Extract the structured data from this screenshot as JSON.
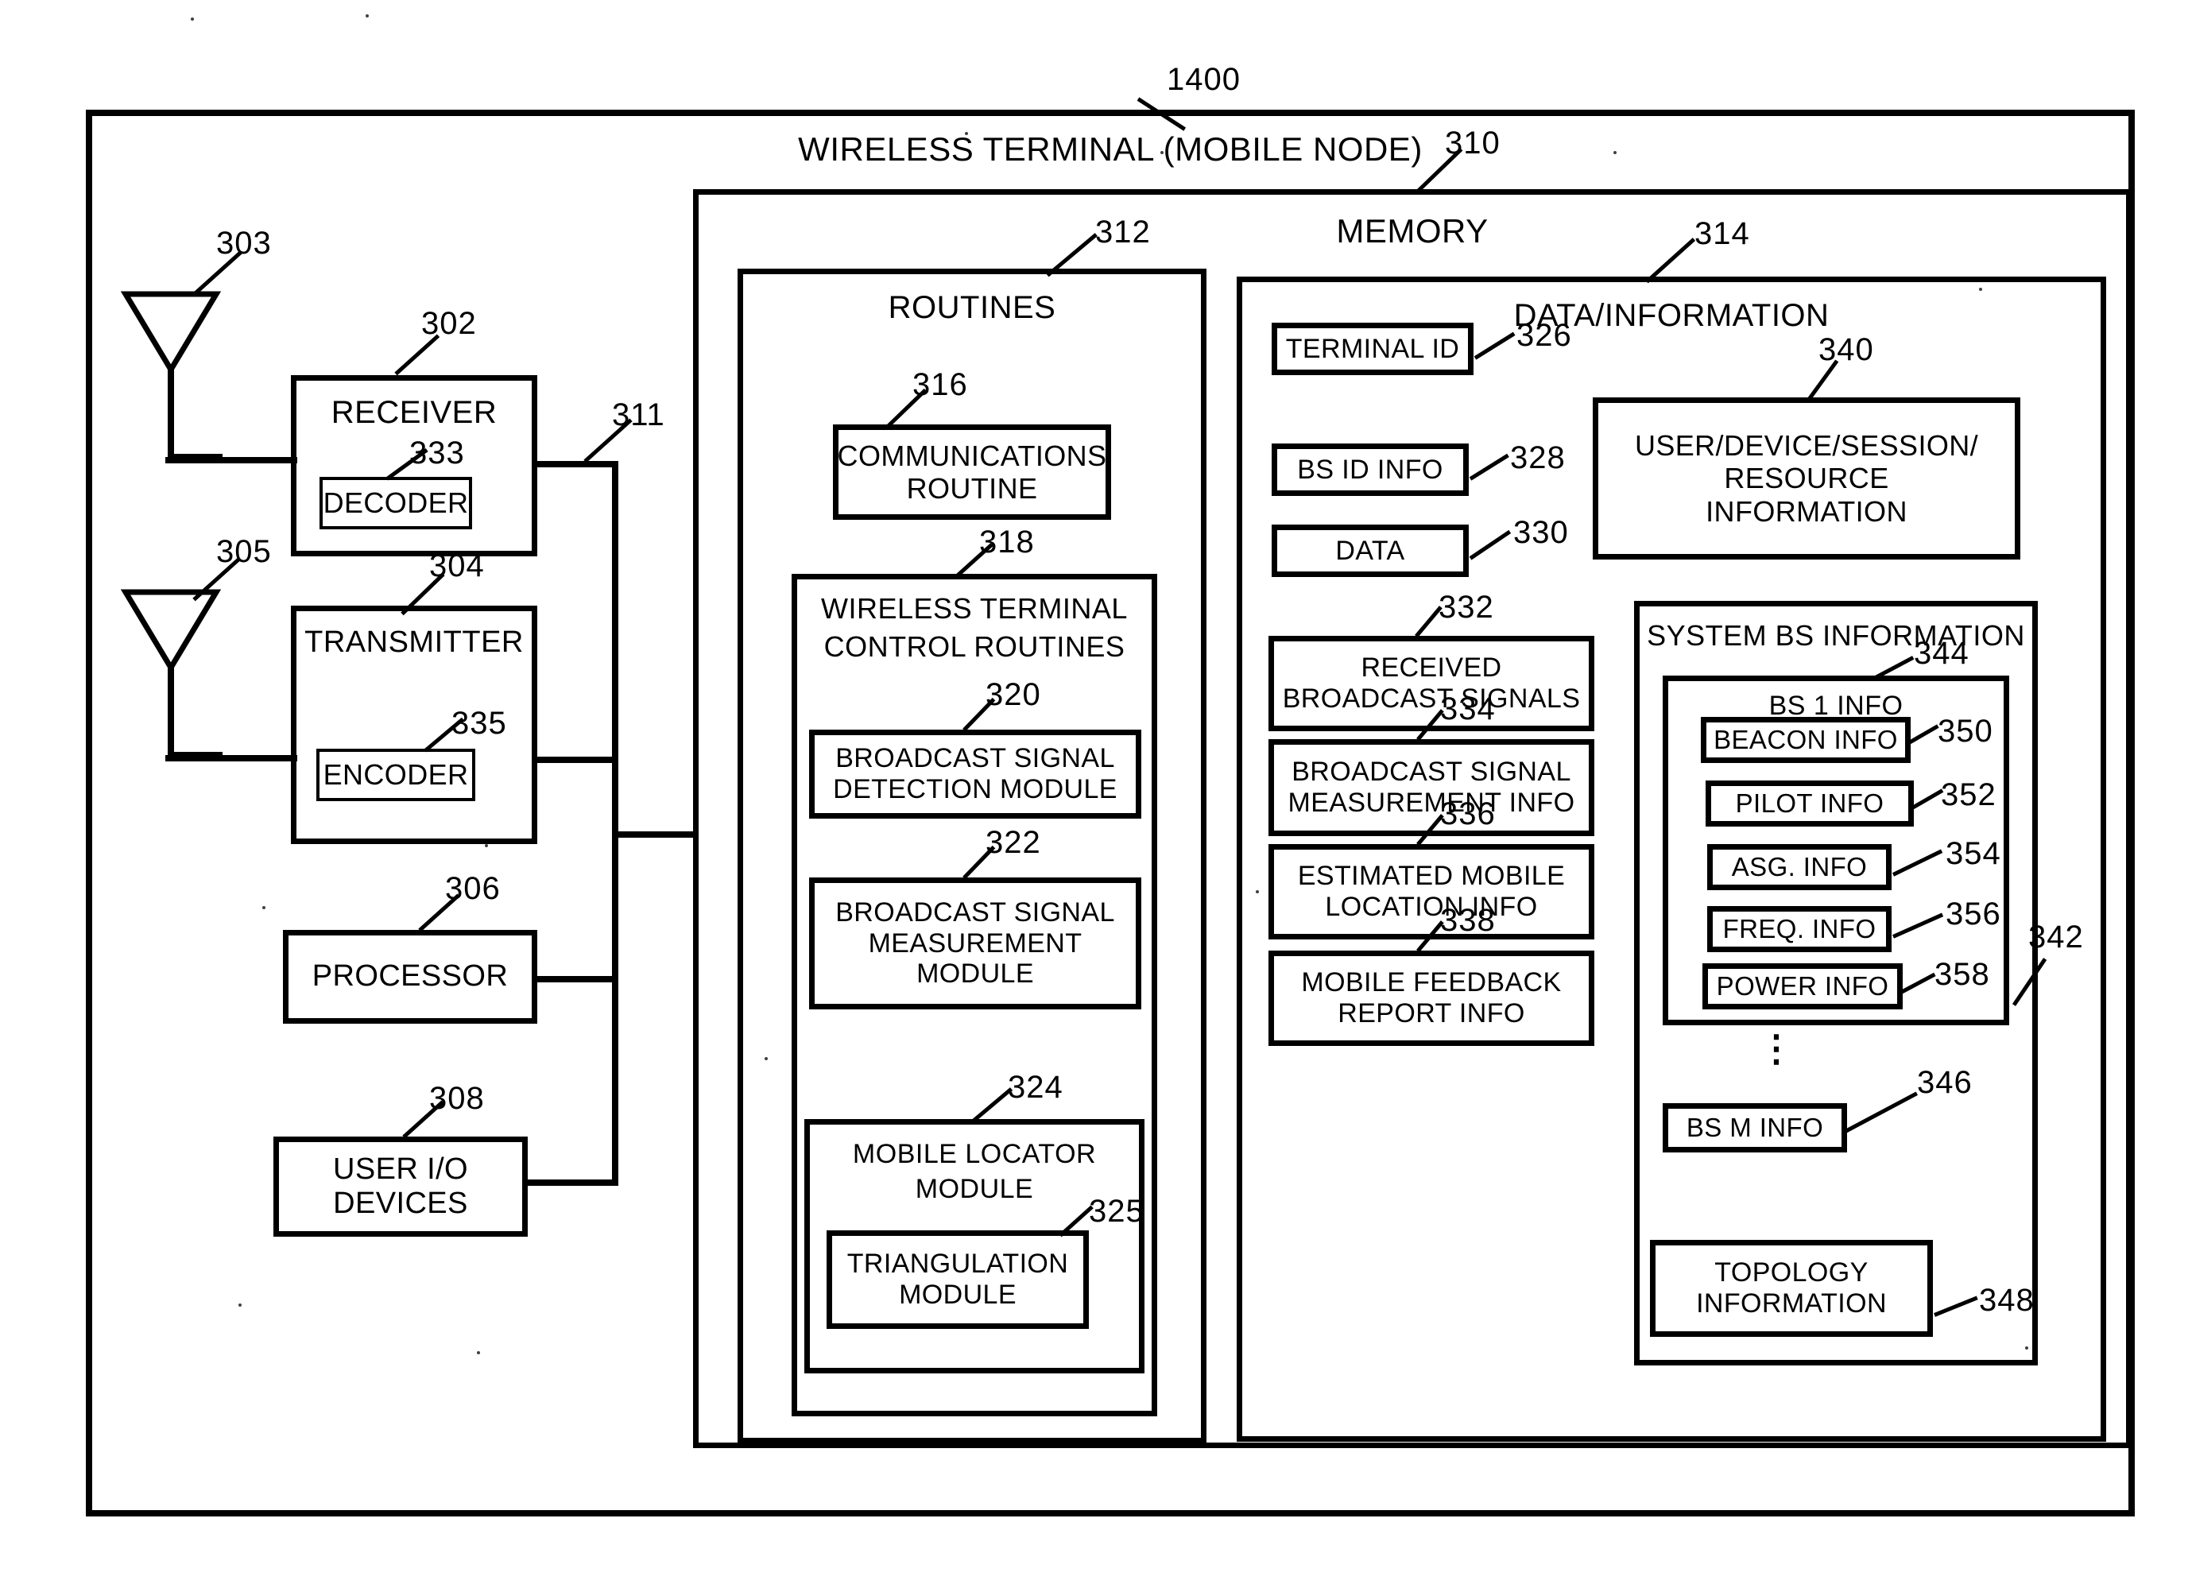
{
  "figure": {
    "outer_label": "1400",
    "outer_title": "WIRELESS TERMINAL (MOBILE NODE)"
  },
  "left_column": {
    "antenna_rx_ref": "303",
    "antenna_tx_ref": "305",
    "receiver": {
      "label": "RECEIVER",
      "ref": "302"
    },
    "decoder": {
      "label": "DECODER",
      "ref": "333"
    },
    "transmitter": {
      "label": "TRANSMITTER",
      "ref": "304"
    },
    "encoder": {
      "label": "ENCODER",
      "ref": "335"
    },
    "processor": {
      "label": "PROCESSOR",
      "ref": "306"
    },
    "user_io": {
      "label": "USER I/O\nDEVICES",
      "line1": "USER I/O",
      "line2": "DEVICES",
      "ref": "308"
    },
    "bus_ref": "311"
  },
  "memory": {
    "label": "MEMORY",
    "ref": "310",
    "routines": {
      "label": "ROUTINES",
      "ref": "312",
      "communications_routine": {
        "line1": "COMMUNICATIONS",
        "line2": "ROUTINE",
        "ref": "316"
      },
      "control_routines": {
        "line1": "WIRELESS TERMINAL",
        "line2": "CONTROL ROUTINES",
        "ref": "318",
        "modules": [
          {
            "line1": "BROADCAST SIGNAL",
            "line2": "DETECTION MODULE",
            "line3": "",
            "ref": "320"
          },
          {
            "line1": "BROADCAST SIGNAL",
            "line2": "MEASUREMENT",
            "line3": "MODULE",
            "ref": "322"
          },
          {
            "line1": "MOBILE LOCATOR",
            "line2": "MODULE",
            "line3": "",
            "ref": "324"
          }
        ],
        "triangulation_module": {
          "line1": "TRIANGULATION",
          "line2": "MODULE",
          "ref": "325"
        }
      }
    },
    "data_information": {
      "label": "DATA/INFORMATION",
      "ref": "314",
      "small_items": [
        {
          "label": "TERMINAL ID",
          "ref": "326"
        },
        {
          "label": "BS ID INFO",
          "ref": "328"
        },
        {
          "label": "DATA",
          "ref": "330"
        }
      ],
      "stacked_items": [
        {
          "line1": "RECEIVED",
          "line2": "BROADCAST SIGNALS",
          "ref": "332"
        },
        {
          "line1": "BROADCAST SIGNAL",
          "line2": "MEASUREMENT INFO",
          "ref": "334"
        },
        {
          "line1": "ESTIMATED MOBILE",
          "line2": "LOCATION INFO",
          "ref": "336"
        },
        {
          "line1": "MOBILE FEEDBACK",
          "line2": "REPORT INFO",
          "ref": "338"
        }
      ],
      "user_device_session": {
        "line1": "USER/DEVICE/SESSION/",
        "line2": "RESOURCE",
        "line3": "INFORMATION",
        "ref": "340"
      },
      "system_bs_information": {
        "label": "SYSTEM BS INFORMATION",
        "ref": "342",
        "bs1": {
          "label": "BS 1 INFO",
          "ref": "344",
          "items": [
            {
              "label": "BEACON INFO",
              "ref": "350"
            },
            {
              "label": "PILOT INFO",
              "ref": "352"
            },
            {
              "label": "ASG. INFO",
              "ref": "354"
            },
            {
              "label": "FREQ. INFO",
              "ref": "356"
            },
            {
              "label": "POWER INFO",
              "ref": "358"
            }
          ]
        },
        "ellipsis": "⋮",
        "bs_m": {
          "label": "BS M INFO",
          "ref": "346"
        },
        "topology": {
          "line1": "TOPOLOGY",
          "line2": "INFORMATION",
          "ref": "348"
        }
      }
    }
  }
}
